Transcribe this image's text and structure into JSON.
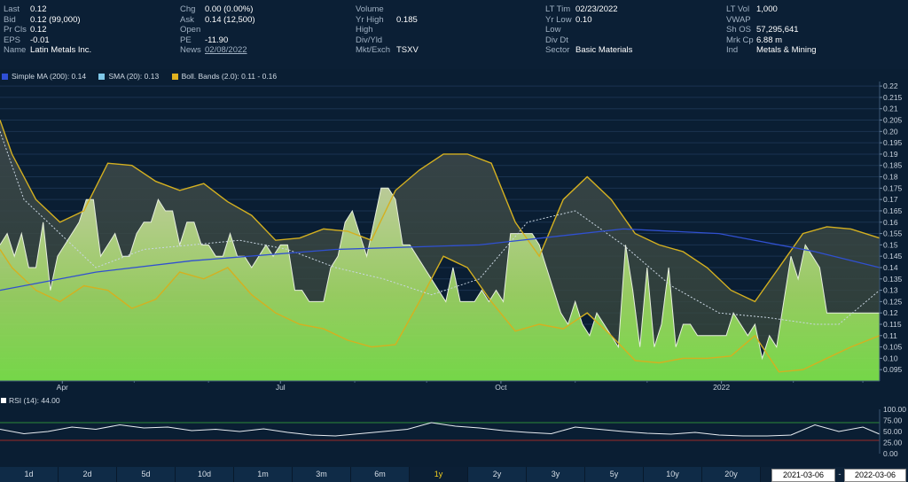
{
  "quote": {
    "col1": [
      {
        "label": "Last",
        "value": "0.12"
      },
      {
        "label": "Bid",
        "value": "0.12 (99,000)"
      },
      {
        "label": "Pr Cls",
        "value": "0.12"
      },
      {
        "label": "EPS",
        "value": "-0.01"
      },
      {
        "label": "Name",
        "value": "Latin Metals Inc."
      }
    ],
    "col2": [
      {
        "label": "Chg",
        "value": "0.00 (0.00%)"
      },
      {
        "label": "Ask",
        "value": "0.14 (12,500)"
      },
      {
        "label": "Open",
        "value": ""
      },
      {
        "label": "PE",
        "value": "-11.90"
      },
      {
        "label": "News",
        "value": "02/08/2022"
      }
    ],
    "col3": [
      {
        "label": "Volume",
        "value": ""
      },
      {
        "label": "Yr High",
        "value": "0.185"
      },
      {
        "label": "High",
        "value": ""
      },
      {
        "label": "Div/Yld",
        "value": ""
      },
      {
        "label": "Mkt/Exch",
        "value": "TSXV"
      }
    ],
    "col4": [
      {
        "label": "LT Tim",
        "value": "02/23/2022"
      },
      {
        "label": "Yr Low",
        "value": "0.10"
      },
      {
        "label": "Low",
        "value": ""
      },
      {
        "label": "Div Dt",
        "value": ""
      },
      {
        "label": "Sector",
        "value": "Basic Materials"
      }
    ],
    "col5": [
      {
        "label": "LT Vol",
        "value": "1,000"
      },
      {
        "label": "VWAP",
        "value": ""
      },
      {
        "label": "Sh OS",
        "value": "57,295,641"
      },
      {
        "label": "Mrk Cp",
        "value": "6.88 m"
      },
      {
        "label": "Ind",
        "value": "Metals & Mining"
      }
    ]
  },
  "legend": [
    {
      "text": "Simple MA (200): 0.14",
      "color": "#2f4fd6"
    },
    {
      "text": "SMA (20): 0.13",
      "color": "#7fc8e8"
    },
    {
      "text": "Boll. Bands (2.0): 0.11 - 0.16",
      "color": "#e0b21f"
    }
  ],
  "rsi_label": "RSI (14): 44.00",
  "periods": [
    {
      "label": "1d",
      "active": false
    },
    {
      "label": "2d",
      "active": false
    },
    {
      "label": "5d",
      "active": false
    },
    {
      "label": "10d",
      "active": false
    },
    {
      "label": "1m",
      "active": false
    },
    {
      "label": "3m",
      "active": false
    },
    {
      "label": "6m",
      "active": false
    },
    {
      "label": "1y",
      "active": true
    },
    {
      "label": "2y",
      "active": false
    },
    {
      "label": "3y",
      "active": false
    },
    {
      "label": "5y",
      "active": false
    },
    {
      "label": "10y",
      "active": false
    },
    {
      "label": "20y",
      "active": false
    }
  ],
  "date_range": {
    "start": "2021-03-06",
    "separator": "-",
    "end": "2022-03-06"
  },
  "colors": {
    "price_fill_top": "#b6dc7a",
    "price_fill_bottom": "#7ee64a",
    "band": "#d4b020",
    "sma200": "#3050d0",
    "sma20": "#c9d6e2",
    "rsi_line": "#e8edf2",
    "rsi_upper": "#2c8a3a",
    "rsi_lower": "#9a2a2a"
  },
  "chart_data": [
    {
      "type": "area",
      "title": "",
      "y_axis_ticks": [
        "0.22",
        "0.215",
        "0.21",
        "0.205",
        "0.20",
        "0.195",
        "0.19",
        "0.185",
        "0.18",
        "0.175",
        "0.17",
        "0.165",
        "0.16",
        "0.155",
        "0.15",
        "0.145",
        "0.14",
        "0.135",
        "0.13",
        "0.125",
        "0.12",
        "0.115",
        "0.11",
        "0.105",
        "0.10",
        "0.095"
      ],
      "x_axis_ticks": [
        "Apr",
        "Jul",
        "Oct",
        "2022"
      ],
      "ylim": [
        0.09,
        0.222
      ],
      "x_range": [
        "2021-03-06",
        "2022-03-06"
      ],
      "series": [
        {
          "name": "Simple MA (200)",
          "x": [
            0,
            40,
            80,
            140,
            200,
            260,
            300,
            340,
            367
          ],
          "y": [
            0.13,
            0.138,
            0.143,
            0.148,
            0.15,
            0.157,
            0.155,
            0.147,
            0.14
          ]
        },
        {
          "name": "SMA (20)",
          "x": [
            0,
            10,
            20,
            40,
            60,
            80,
            100,
            120,
            140,
            160,
            180,
            200,
            220,
            240,
            260,
            280,
            300,
            320,
            340,
            350,
            367
          ],
          "y": [
            0.2,
            0.17,
            0.16,
            0.14,
            0.148,
            0.15,
            0.152,
            0.148,
            0.14,
            0.135,
            0.128,
            0.135,
            0.16,
            0.165,
            0.15,
            0.132,
            0.12,
            0.118,
            0.115,
            0.115,
            0.13
          ]
        },
        {
          "name": "Boll. Bands upper",
          "x": [
            0,
            5,
            15,
            25,
            35,
            45,
            55,
            65,
            75,
            85,
            95,
            105,
            115,
            125,
            135,
            145,
            155,
            165,
            175,
            185,
            195,
            205,
            215,
            225,
            235,
            245,
            255,
            265,
            275,
            285,
            295,
            305,
            315,
            325,
            335,
            345,
            355,
            367
          ],
          "y": [
            0.205,
            0.19,
            0.17,
            0.16,
            0.165,
            0.186,
            0.185,
            0.178,
            0.174,
            0.177,
            0.169,
            0.163,
            0.152,
            0.153,
            0.157,
            0.156,
            0.152,
            0.174,
            0.183,
            0.19,
            0.19,
            0.186,
            0.16,
            0.145,
            0.17,
            0.18,
            0.17,
            0.155,
            0.15,
            0.147,
            0.14,
            0.13,
            0.125,
            0.14,
            0.155,
            0.158,
            0.157,
            0.153
          ]
        },
        {
          "name": "Boll. Bands lower",
          "x": [
            0,
            5,
            15,
            25,
            35,
            45,
            55,
            65,
            75,
            85,
            95,
            105,
            115,
            125,
            135,
            145,
            155,
            165,
            175,
            185,
            195,
            205,
            215,
            225,
            235,
            245,
            255,
            265,
            275,
            285,
            295,
            305,
            315,
            325,
            335,
            345,
            355,
            367
          ],
          "y": [
            0.148,
            0.14,
            0.13,
            0.125,
            0.132,
            0.13,
            0.122,
            0.126,
            0.138,
            0.135,
            0.14,
            0.128,
            0.12,
            0.115,
            0.113,
            0.108,
            0.105,
            0.106,
            0.125,
            0.145,
            0.14,
            0.125,
            0.112,
            0.115,
            0.113,
            0.12,
            0.11,
            0.099,
            0.098,
            0.1,
            0.1,
            0.101,
            0.11,
            0.094,
            0.095,
            0.1,
            0.105,
            0.11
          ]
        },
        {
          "name": "Price",
          "x": [
            0,
            3,
            6,
            9,
            12,
            15,
            18,
            21,
            24,
            27,
            30,
            33,
            36,
            39,
            42,
            45,
            48,
            51,
            54,
            57,
            60,
            63,
            66,
            69,
            72,
            75,
            78,
            81,
            84,
            87,
            90,
            93,
            96,
            99,
            102,
            105,
            108,
            111,
            114,
            117,
            120,
            123,
            126,
            129,
            132,
            135,
            138,
            141,
            144,
            147,
            150,
            153,
            156,
            159,
            162,
            165,
            168,
            171,
            174,
            177,
            180,
            183,
            186,
            189,
            192,
            195,
            198,
            201,
            204,
            207,
            210,
            213,
            216,
            219,
            222,
            225,
            228,
            231,
            234,
            237,
            240,
            243,
            246,
            249,
            252,
            255,
            258,
            261,
            264,
            267,
            270,
            273,
            276,
            279,
            282,
            285,
            288,
            291,
            294,
            297,
            300,
            303,
            306,
            309,
            312,
            315,
            318,
            321,
            324,
            327,
            330,
            333,
            336,
            339,
            342,
            345,
            348,
            351,
            354,
            357,
            360,
            363,
            367
          ],
          "y": [
            0.15,
            0.155,
            0.145,
            0.155,
            0.14,
            0.14,
            0.16,
            0.13,
            0.145,
            0.15,
            0.155,
            0.16,
            0.17,
            0.17,
            0.145,
            0.15,
            0.155,
            0.145,
            0.145,
            0.155,
            0.16,
            0.16,
            0.17,
            0.165,
            0.165,
            0.15,
            0.16,
            0.16,
            0.15,
            0.15,
            0.145,
            0.145,
            0.155,
            0.145,
            0.145,
            0.14,
            0.145,
            0.15,
            0.145,
            0.15,
            0.15,
            0.13,
            0.13,
            0.125,
            0.125,
            0.125,
            0.14,
            0.145,
            0.16,
            0.165,
            0.155,
            0.145,
            0.16,
            0.175,
            0.175,
            0.17,
            0.15,
            0.15,
            0.145,
            0.14,
            0.135,
            0.13,
            0.125,
            0.14,
            0.125,
            0.125,
            0.125,
            0.13,
            0.125,
            0.13,
            0.125,
            0.155,
            0.155,
            0.155,
            0.155,
            0.15,
            0.14,
            0.13,
            0.12,
            0.115,
            0.125,
            0.115,
            0.11,
            0.12,
            0.115,
            0.11,
            0.105,
            0.15,
            0.13,
            0.105,
            0.14,
            0.105,
            0.115,
            0.14,
            0.105,
            0.115,
            0.115,
            0.11,
            0.11,
            0.11,
            0.11,
            0.11,
            0.12,
            0.115,
            0.11,
            0.115,
            0.1,
            0.11,
            0.105,
            0.125,
            0.145,
            0.135,
            0.15,
            0.145,
            0.14,
            0.12,
            0.12,
            0.12,
            0.12,
            0.12,
            0.12,
            0.12,
            0.12
          ]
        }
      ]
    },
    {
      "type": "line",
      "title": "RSI (14): 44.00",
      "y_axis_ticks": [
        "100.00",
        "75.00",
        "50.00",
        "25.00",
        "0.00"
      ],
      "ylim": [
        0,
        100
      ],
      "series": [
        {
          "name": "RSI (14)",
          "x": [
            0,
            10,
            20,
            30,
            40,
            50,
            60,
            70,
            80,
            90,
            100,
            110,
            120,
            130,
            140,
            150,
            160,
            170,
            180,
            190,
            200,
            210,
            220,
            230,
            240,
            250,
            260,
            270,
            280,
            290,
            300,
            310,
            320,
            330,
            340,
            350,
            360,
            367
          ],
          "y": [
            55,
            45,
            50,
            60,
            55,
            65,
            58,
            60,
            52,
            55,
            50,
            56,
            48,
            42,
            40,
            45,
            50,
            55,
            70,
            62,
            58,
            52,
            48,
            45,
            60,
            55,
            50,
            46,
            44,
            48,
            42,
            40,
            40,
            42,
            65,
            50,
            60,
            44
          ]
        }
      ]
    }
  ]
}
